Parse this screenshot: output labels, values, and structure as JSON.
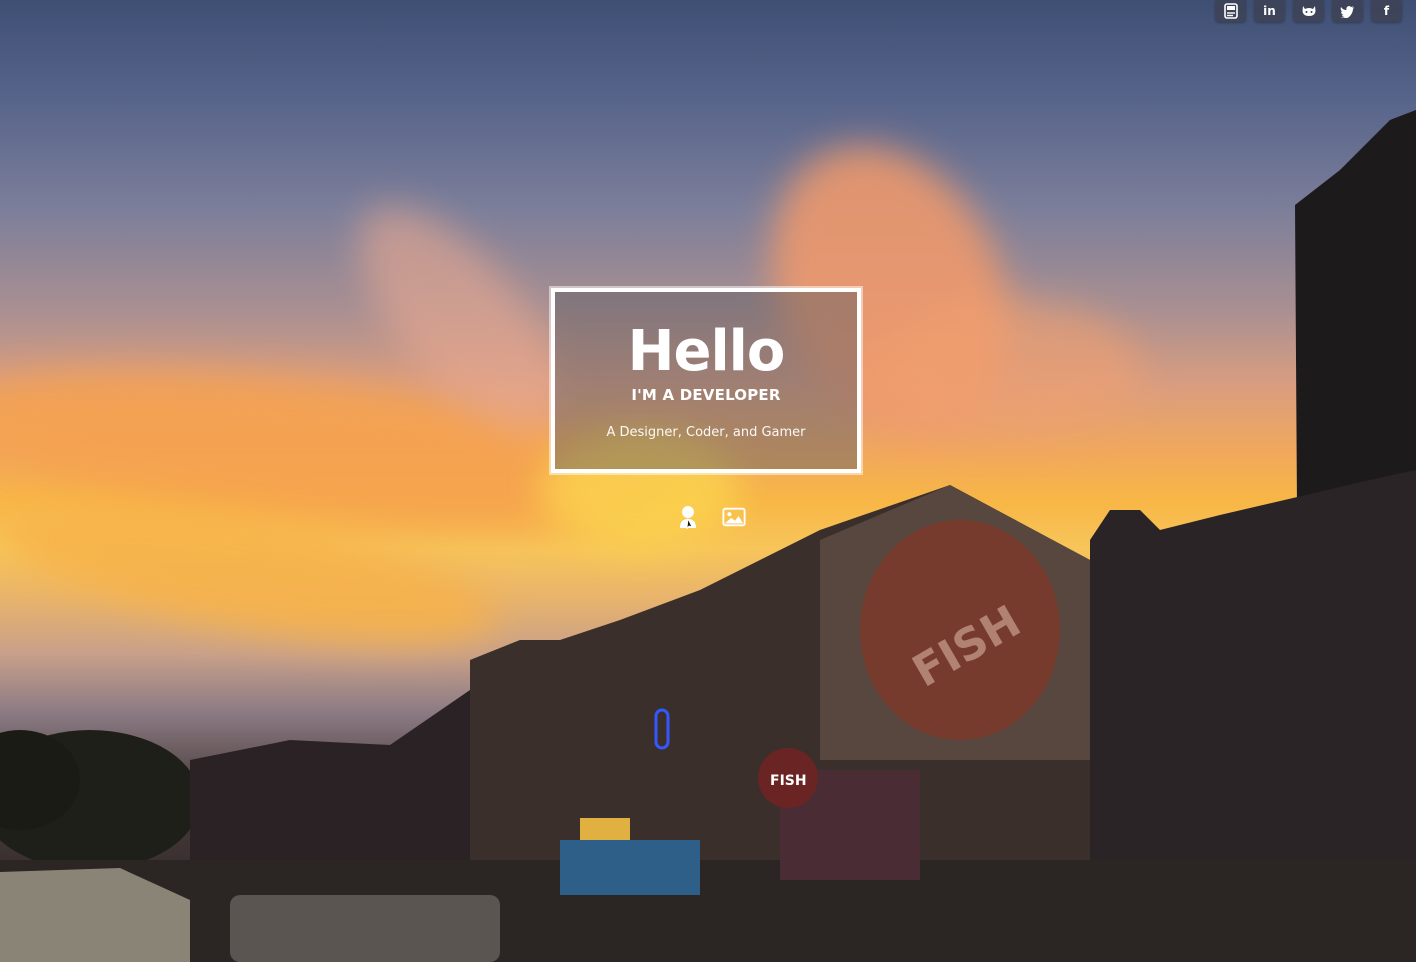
{
  "social": [
    {
      "name": "pdf",
      "label": "PDF"
    },
    {
      "name": "linkedin",
      "label": "in"
    },
    {
      "name": "github",
      "label": "gh"
    },
    {
      "name": "twitter",
      "label": "tw"
    },
    {
      "name": "facebook",
      "label": "f"
    }
  ],
  "hero": {
    "title": "Hello",
    "subtitle": "I'M A DEVELOPER",
    "tagline": "A Designer, Coder, and Gamer"
  },
  "toggles": [
    {
      "name": "profile-view-icon"
    },
    {
      "name": "gallery-view-icon"
    }
  ],
  "colors": {
    "box_border": "#ffffff",
    "sky_top": "#3f4f74",
    "sunset": "#f8b646"
  }
}
